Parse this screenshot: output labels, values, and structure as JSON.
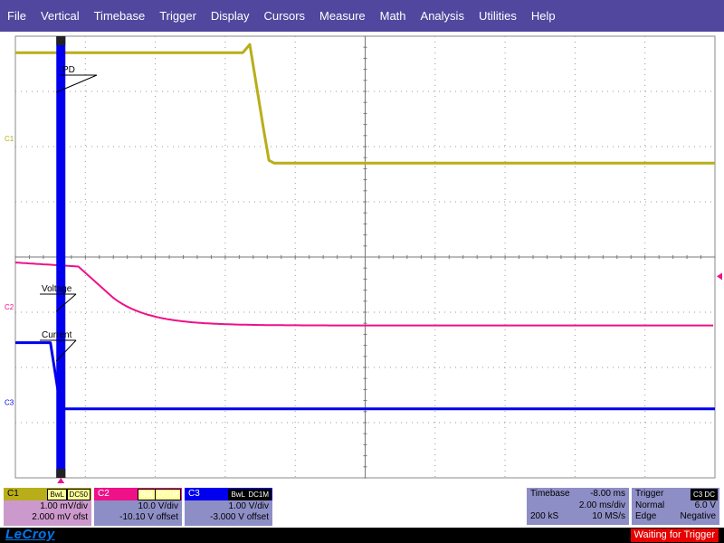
{
  "menu": [
    "File",
    "Vertical",
    "Timebase",
    "Trigger",
    "Display",
    "Cursors",
    "Measure",
    "Math",
    "Analysis",
    "Utilities",
    "Help"
  ],
  "labels": {
    "pd": "PD",
    "voltage": "Voltage",
    "current": "Current"
  },
  "channel_markers": {
    "c1": "C1",
    "c2": "C2",
    "c3": "C3"
  },
  "channels": [
    {
      "name": "C1",
      "badges": [
        "BwL",
        "DC50"
      ],
      "line1": "1.00 mV/div",
      "line2": "2.000 mV ofst",
      "color": "#b8ae1a",
      "body": "#cc99cc"
    },
    {
      "name": "C2",
      "badges": [
        "BwL",
        "DC1M"
      ],
      "line1": "10.0 V/div",
      "line2": "-10.10 V offset",
      "color": "#ee1188",
      "body": "#8e8ec6"
    },
    {
      "name": "C3",
      "badges": [
        "BwL",
        "DC1M"
      ],
      "line1": "1.00 V/div",
      "line2": "-3.000 V offset",
      "color": "#0000ee",
      "body": "#8e8ec6"
    }
  ],
  "timebase": {
    "title": "Timebase",
    "delay": "-8.00 ms",
    "per_div": "2.00 ms/div",
    "samples": "200 kS",
    "rate": "10 MS/s"
  },
  "trigger": {
    "title": "Trigger",
    "badge": "C3 DC",
    "mode": "Normal",
    "level": "6.0 V",
    "type": "Edge",
    "slope": "Negative"
  },
  "logo": "LeCroy",
  "status": "Waiting for Trigger",
  "colors": {
    "menubar": "#52479e",
    "c1": "#b8ae1a",
    "c2": "#ee1188",
    "c3": "#0000ee",
    "grid": "#999999"
  },
  "chart_data": {
    "type": "line",
    "x_unit": "ms",
    "xlim": [
      -8,
      12
    ],
    "series": [
      {
        "name": "C1",
        "points": [
          [
            -8,
            2.0
          ],
          [
            -7.3,
            2.0
          ],
          [
            -7.0,
            2.0
          ],
          [
            -1.5,
            2.0
          ],
          [
            -1.3,
            2.15
          ],
          [
            -0.9,
            0.6
          ],
          [
            -0.75,
            0.05
          ],
          [
            -0.6,
            0.0
          ],
          [
            12,
            0.0
          ]
        ]
      },
      {
        "name": "C2",
        "points": [
          [
            -8,
            10.0
          ],
          [
            -7.0,
            9.6
          ],
          [
            -6.0,
            9.0
          ],
          [
            -5.2,
            3.6
          ],
          [
            -4.8,
            0.9
          ],
          [
            -4.0,
            -0.1
          ],
          [
            -3.0,
            -0.9
          ],
          [
            -2.0,
            -1.2
          ],
          [
            0.0,
            -1.3
          ],
          [
            12,
            -1.4
          ]
        ]
      },
      {
        "name": "C3",
        "points": [
          [
            -8,
            1.2
          ],
          [
            -7.0,
            1.2
          ],
          [
            -6.7,
            0.0
          ],
          [
            12,
            0.0
          ]
        ]
      }
    ]
  }
}
